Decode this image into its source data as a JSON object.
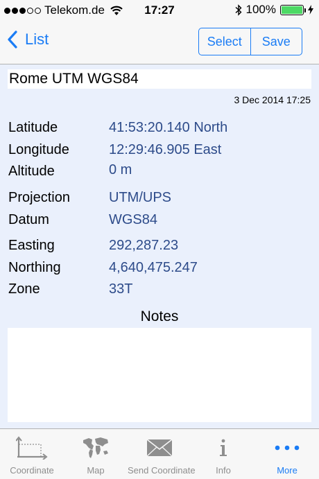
{
  "status_bar": {
    "carrier": "Telekom.de",
    "time": "17:27",
    "battery": "100%",
    "battery_level": 1.0
  },
  "nav": {
    "back_label": "List",
    "select_label": "Select",
    "save_label": "Save"
  },
  "record": {
    "name": "Rome UTM WGS84",
    "date": "3 Dec 2014 17:25",
    "fields": [
      {
        "label": "Latitude",
        "value": "41:53:20.140 North"
      },
      {
        "label": "Longitude",
        "value": "12:29:46.905 East"
      },
      {
        "label": "Altitude",
        "value": "0 m"
      },
      {
        "label": "Projection",
        "value": "UTM/UPS"
      },
      {
        "label": "Datum",
        "value": "WGS84"
      },
      {
        "label": "Easting",
        "value": "292,287.23"
      },
      {
        "label": "Northing",
        "value": "4,640,475.247"
      },
      {
        "label": "Zone",
        "value": "33T"
      }
    ],
    "notes_title": "Notes",
    "notes": ""
  },
  "tabs": [
    {
      "label": "Coordinate",
      "icon": "coordinate-axes-icon"
    },
    {
      "label": "Map",
      "icon": "world-map-icon"
    },
    {
      "label": "Send Coordinate",
      "icon": "envelope-icon"
    },
    {
      "label": "Info",
      "icon": "info-icon"
    },
    {
      "label": "More",
      "icon": "more-dots-icon"
    }
  ],
  "colors": {
    "accent": "#1a7cf5",
    "value_text": "#2d4b8a",
    "content_bg": "#eaf0fc",
    "battery": "#4cd964"
  }
}
